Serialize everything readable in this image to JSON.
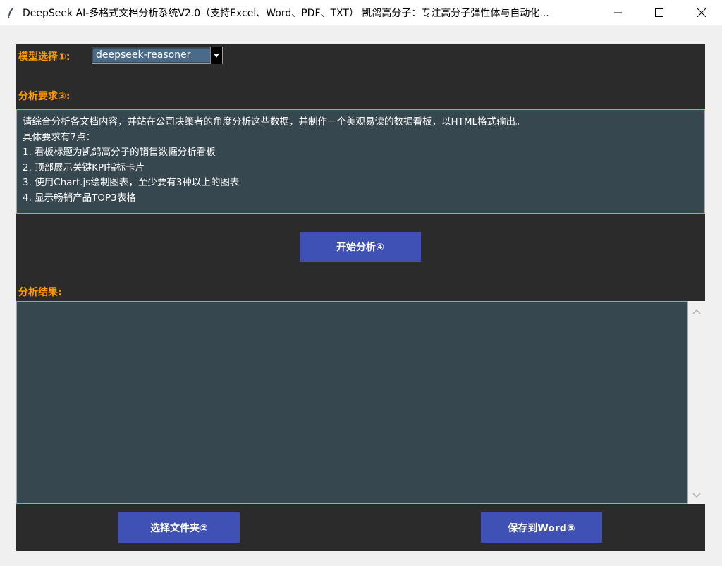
{
  "window": {
    "title": "DeepSeek AI-多格式文档分析系统V2.0（支持Excel、Word、PDF、TXT） 凯鸽高分子：专注高分子弹性体与自动化...",
    "icons": {
      "app": "feather-icon",
      "minimize": "minimize-icon",
      "maximize": "maximize-icon",
      "close": "close-icon"
    }
  },
  "model": {
    "label": "模型选择①:",
    "selected": "deepseek-reasoner"
  },
  "requirements": {
    "label": "分析要求③:",
    "lines": [
      "请综合分析各文档内容，并站在公司决策者的角度分析这些数据，并制作一个美观易读的数据看板，以HTML格式输出。",
      "具体要求有7点：",
      "1. 看板标题为凯鸽高分子的销售数据分析看板",
      "2. 顶部展示关键KPI指标卡片",
      "3. 使用Chart.js绘制图表，至少要有3种以上的图表",
      "4. 显示畅销产品TOP3表格"
    ]
  },
  "actions": {
    "start": "开始分析④",
    "select_folder": "选择文件夹②",
    "save_word": "保存到Word⑤"
  },
  "result": {
    "label": "分析结果:",
    "content": ""
  },
  "colors": {
    "accent": "#ff9a00",
    "panel": "#2b2b2b",
    "textbox": "#37474f",
    "button": "#3f51b5"
  }
}
